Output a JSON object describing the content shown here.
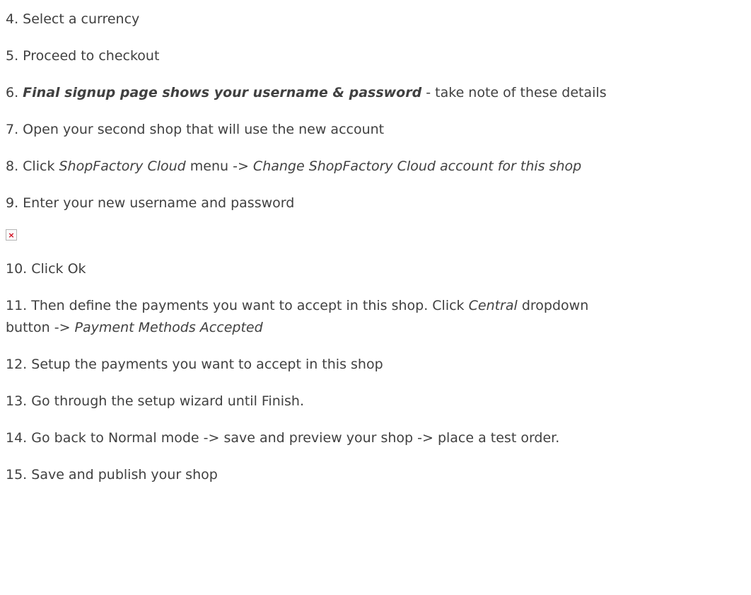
{
  "steps": {
    "s4": {
      "text": "4. Select a currency"
    },
    "s5": {
      "text": "5. Proceed to checkout"
    },
    "s6": {
      "num": "6. ",
      "bold": "Final signup page shows your username & password",
      "rest": " - take note of these details"
    },
    "s7": {
      "text": "7. Open your second shop that will use the new account"
    },
    "s8": {
      "num": "8. Click ",
      "em1": "ShopFactory Cloud",
      "mid": " menu -> ",
      "em2": "Change ShopFactory Cloud account for this shop"
    },
    "s9": {
      "text": "9. Enter your new username and password"
    },
    "s10": {
      "text": "10. Click Ok"
    },
    "s11": {
      "num": "11. Then define the payments you want to accept in this shop. Click ",
      "em1": "Central",
      "mid": " dropdown button -> ",
      "em2": "Payment Methods Accepted"
    },
    "s12": {
      "text": "12. Setup the payments you want to accept in this shop"
    },
    "s13": {
      "text": "13. Go through the setup wizard until Finish."
    },
    "s14": {
      "text": "14. Go back to Normal mode -> save and preview your shop -> place a test order."
    },
    "s15": {
      "text": "15. Save and publish your shop"
    }
  },
  "broken_image": {
    "glyph": "×",
    "icon": "broken-image-icon",
    "color": "#d0021b"
  }
}
